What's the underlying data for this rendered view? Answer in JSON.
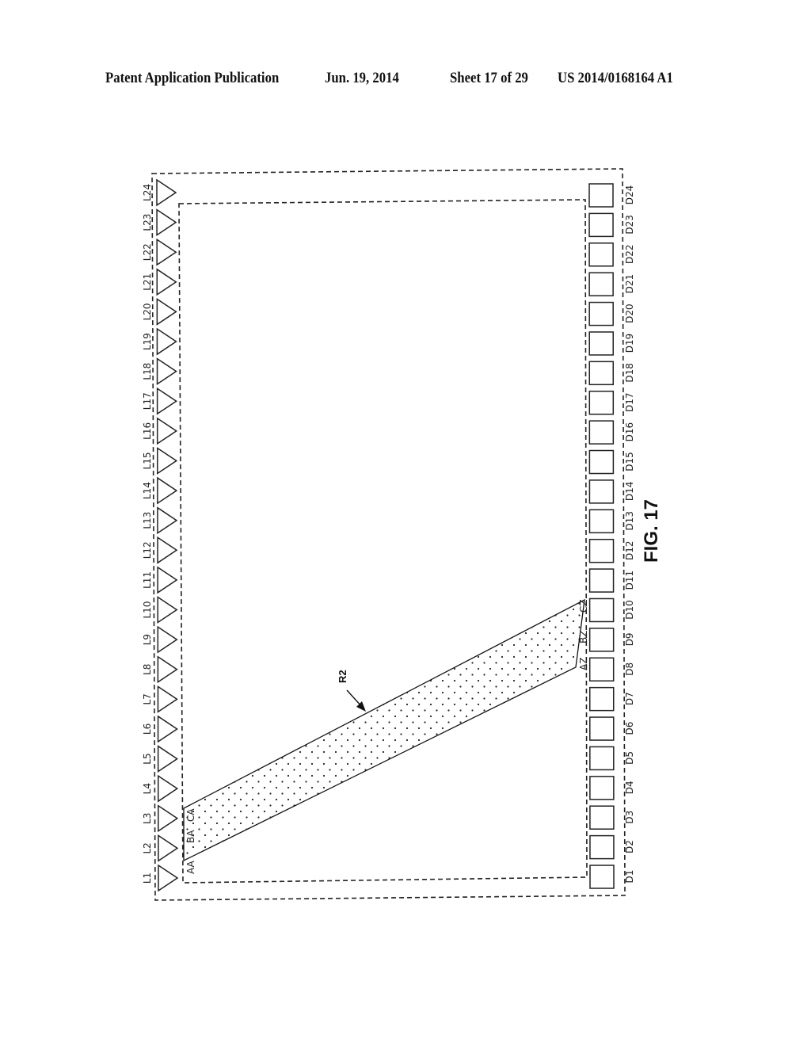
{
  "header": {
    "publication": "Patent Application Publication",
    "date": "Jun. 19, 2014",
    "sheet": "Sheet 17 of 29",
    "number": "US 2014/0168164 A1"
  },
  "figure": {
    "caption": "FIG. 17",
    "region_label": "R2",
    "left_elements": [
      "L1",
      "L2",
      "L3",
      "L4",
      "L5",
      "L6",
      "L7",
      "L8",
      "L9",
      "L10",
      "L11",
      "L12",
      "L13",
      "L14",
      "L15",
      "L16",
      "L17",
      "L18",
      "L19",
      "L20",
      "L21",
      "L22",
      "L23",
      "L24"
    ],
    "right_elements": [
      "D1",
      "D2",
      "D3",
      "D4",
      "D5",
      "D6",
      "D7",
      "D8",
      "D9",
      "D10",
      "D11",
      "D12",
      "D13",
      "D14",
      "D15",
      "D16",
      "D17",
      "D18",
      "D19",
      "D20",
      "D21",
      "D22",
      "D23",
      "D24"
    ],
    "left_element_shape": "triangle",
    "right_element_shape": "square",
    "band_start_points": [
      "AA",
      "BA",
      "CA"
    ],
    "band_end_points": [
      "AZ",
      "BZ",
      "CZ"
    ],
    "band_fill": "dotted"
  }
}
